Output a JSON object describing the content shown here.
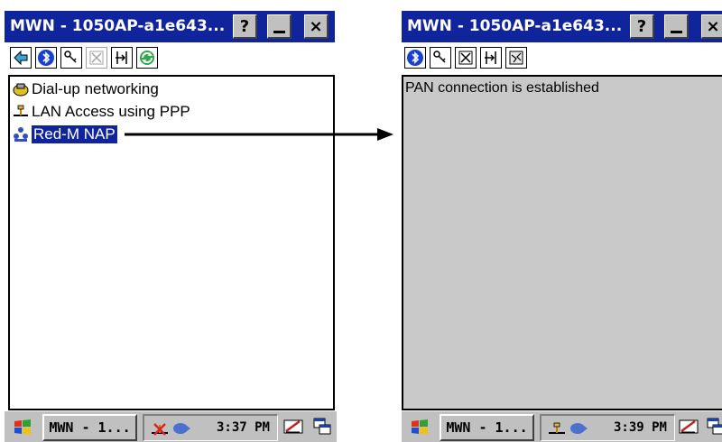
{
  "left_window": {
    "title": "MWN - 1050AP-a1e643...",
    "help_label": "?",
    "close_label": "×",
    "toolbar_icons": [
      "back-icon",
      "bluetooth-icon",
      "key-icon",
      "disabled-x-icon",
      "connect-icon",
      "refresh-icon"
    ],
    "list": [
      {
        "label": "Dial-up networking",
        "icon": "dialup-icon",
        "selected": false
      },
      {
        "label": "LAN Access using PPP",
        "icon": "lan-icon",
        "selected": false
      },
      {
        "label": "Red-M NAP",
        "icon": "nap-icon",
        "selected": true
      }
    ],
    "taskbar": {
      "task_label": "MWN - 1...",
      "clock": "3:37 PM",
      "tray_icons": [
        "network-disconnected-icon",
        "bluetooth-tray-icon"
      ]
    }
  },
  "right_window": {
    "title": "MWN - 1050AP-a1e643...",
    "help_label": "?",
    "close_label": "×",
    "toolbar_icons": [
      "bluetooth-icon",
      "key-icon",
      "x-box-icon",
      "connect-icon",
      "disconnect-icon"
    ],
    "status_message": "PAN connection is established",
    "taskbar": {
      "task_label": "MWN - 1...",
      "clock": "3:39 PM",
      "tray_icons": [
        "network-connected-icon",
        "bluetooth-tray-icon"
      ]
    }
  },
  "colors": {
    "titlebar": "#10249c",
    "selection": "#10249c",
    "panel_gray": "#c9c9c9",
    "taskbar": "#c0c0c0",
    "arrow": "#000000"
  }
}
